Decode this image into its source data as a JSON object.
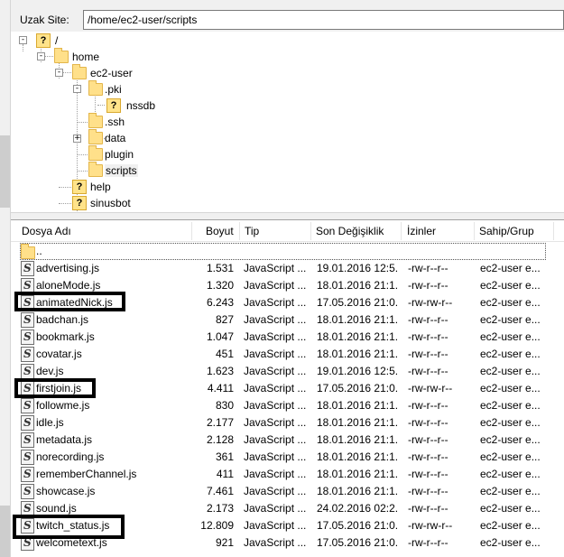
{
  "remote_site": {
    "label": "Uzak Site:",
    "path": "/home/ec2-user/scripts"
  },
  "tree": [
    {
      "name": "/",
      "icon": "unknown"
    },
    {
      "name": "home",
      "icon": "folder"
    },
    {
      "name": "ec2-user",
      "icon": "folder"
    },
    {
      "name": ".pki",
      "icon": "folder"
    },
    {
      "name": "nssdb",
      "icon": "unknown"
    },
    {
      "name": ".ssh",
      "icon": "folder"
    },
    {
      "name": "data",
      "icon": "folder"
    },
    {
      "name": "plugin",
      "icon": "folder"
    },
    {
      "name": "scripts",
      "icon": "folder"
    },
    {
      "name": "help",
      "icon": "unknown"
    },
    {
      "name": "sinusbot",
      "icon": "unknown"
    }
  ],
  "columns": {
    "name": "Dosya Adı",
    "size": "Boyut",
    "type": "Tip",
    "modified": "Son Değişiklik",
    "permissions": "İzinler",
    "owner": "Sahip/Grup"
  },
  "parent_dir": "..",
  "files": [
    {
      "name": "advertising.js",
      "size": "1.531",
      "type": "JavaScript ...",
      "modified": "19.01.2016 12:5...",
      "perm": "-rw-r--r--",
      "owner": "ec2-user e..."
    },
    {
      "name": "aloneMode.js",
      "size": "1.320",
      "type": "JavaScript ...",
      "modified": "18.01.2016 21:1...",
      "perm": "-rw-r--r--",
      "owner": "ec2-user e..."
    },
    {
      "name": "animatedNick.js",
      "size": "6.243",
      "type": "JavaScript ...",
      "modified": "17.05.2016 21:0...",
      "perm": "-rw-rw-r--",
      "owner": "ec2-user e..."
    },
    {
      "name": "badchan.js",
      "size": "827",
      "type": "JavaScript ...",
      "modified": "18.01.2016 21:1...",
      "perm": "-rw-r--r--",
      "owner": "ec2-user e..."
    },
    {
      "name": "bookmark.js",
      "size": "1.047",
      "type": "JavaScript ...",
      "modified": "18.01.2016 21:1...",
      "perm": "-rw-r--r--",
      "owner": "ec2-user e..."
    },
    {
      "name": "covatar.js",
      "size": "451",
      "type": "JavaScript ...",
      "modified": "18.01.2016 21:1...",
      "perm": "-rw-r--r--",
      "owner": "ec2-user e..."
    },
    {
      "name": "dev.js",
      "size": "1.623",
      "type": "JavaScript ...",
      "modified": "19.01.2016 12:5...",
      "perm": "-rw-r--r--",
      "owner": "ec2-user e..."
    },
    {
      "name": "firstjoin.js",
      "size": "4.411",
      "type": "JavaScript ...",
      "modified": "17.05.2016 21:0...",
      "perm": "-rw-rw-r--",
      "owner": "ec2-user e..."
    },
    {
      "name": "followme.js",
      "size": "830",
      "type": "JavaScript ...",
      "modified": "18.01.2016 21:1...",
      "perm": "-rw-r--r--",
      "owner": "ec2-user e..."
    },
    {
      "name": "idle.js",
      "size": "2.177",
      "type": "JavaScript ...",
      "modified": "18.01.2016 21:1...",
      "perm": "-rw-r--r--",
      "owner": "ec2-user e..."
    },
    {
      "name": "metadata.js",
      "size": "2.128",
      "type": "JavaScript ...",
      "modified": "18.01.2016 21:1...",
      "perm": "-rw-r--r--",
      "owner": "ec2-user e..."
    },
    {
      "name": "norecording.js",
      "size": "361",
      "type": "JavaScript ...",
      "modified": "18.01.2016 21:1...",
      "perm": "-rw-r--r--",
      "owner": "ec2-user e..."
    },
    {
      "name": "rememberChannel.js",
      "size": "411",
      "type": "JavaScript ...",
      "modified": "18.01.2016 21:1...",
      "perm": "-rw-r--r--",
      "owner": "ec2-user e..."
    },
    {
      "name": "showcase.js",
      "size": "7.461",
      "type": "JavaScript ...",
      "modified": "18.01.2016 21:1...",
      "perm": "-rw-r--r--",
      "owner": "ec2-user e..."
    },
    {
      "name": "sound.js",
      "size": "2.173",
      "type": "JavaScript ...",
      "modified": "24.02.2016 02:2...",
      "perm": "-rw-r--r--",
      "owner": "ec2-user e..."
    },
    {
      "name": "twitch_status.js",
      "size": "12.809",
      "type": "JavaScript ...",
      "modified": "17.05.2016 21:0...",
      "perm": "-rw-rw-r--",
      "owner": "ec2-user e..."
    },
    {
      "name": "welcometext.js",
      "size": "921",
      "type": "JavaScript ...",
      "modified": "17.05.2016 21:0...",
      "perm": "-rw-r--r--",
      "owner": "ec2-user e..."
    }
  ],
  "icons": {
    "unknown": "?",
    "script": "S",
    "expand": "-",
    "collapse": "+"
  }
}
